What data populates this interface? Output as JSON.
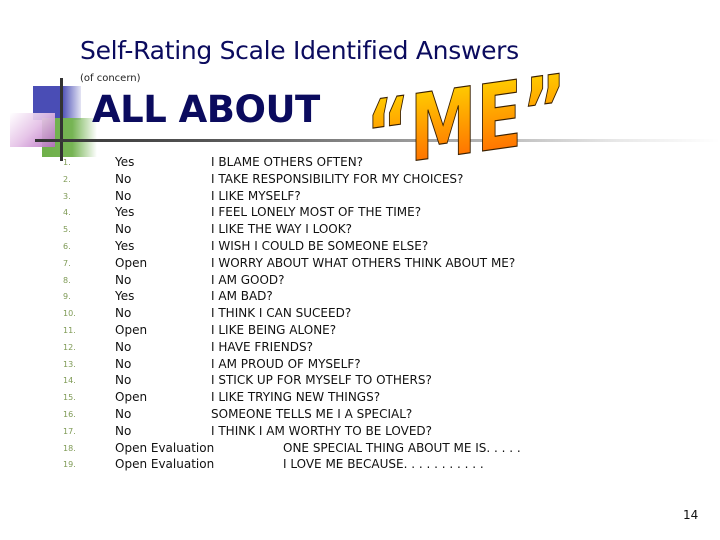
{
  "slide": {
    "title": "Self-Rating Scale Identified Answers",
    "subtitle": "(of concern)",
    "heading": "ALL ABOUT",
    "wordart": "“ME”",
    "page_number": "14"
  },
  "colors": {
    "title": "#0b0b5e",
    "number_marker": "#7e9a55",
    "wordart_top": "#ffe000",
    "wordart_bottom": "#ff5a00"
  },
  "items": [
    {
      "num": "1.",
      "answer": "Yes",
      "question": "I BLAME OTHERS OFTEN?"
    },
    {
      "num": "2.",
      "answer": "No",
      "question": "I TAKE RESPONSIBILITY FOR MY CHOICES?"
    },
    {
      "num": "3.",
      "answer": "No",
      "question": "I LIKE MYSELF?"
    },
    {
      "num": "4.",
      "answer": "Yes",
      "question": "I FEEL LONELY MOST OF THE TIME?"
    },
    {
      "num": "5.",
      "answer": "No",
      "question": "I LIKE THE WAY I LOOK?"
    },
    {
      "num": "6.",
      "answer": "Yes",
      "question": "I WISH I COULD BE SOMEONE ELSE?"
    },
    {
      "num": "7.",
      "answer": "Open",
      "question": "I WORRY ABOUT WHAT OTHERS THINK ABOUT ME?"
    },
    {
      "num": "8.",
      "answer": "No",
      "question": "I AM GOOD?"
    },
    {
      "num": "9.",
      "answer": "Yes",
      "question": "I AM BAD?"
    },
    {
      "num": "10.",
      "answer": "No",
      "question": "I THINK I CAN SUCEED?"
    },
    {
      "num": "11.",
      "answer": "Open",
      "question": "I LIKE BEING ALONE?"
    },
    {
      "num": "12.",
      "answer": "No",
      "question": "I HAVE FRIENDS?"
    },
    {
      "num": "13.",
      "answer": "No",
      "question": "I AM PROUD OF MYSELF?"
    },
    {
      "num": "14.",
      "answer": "No",
      "question": "I STICK UP FOR MYSELF TO OTHERS?"
    },
    {
      "num": "15.",
      "answer": "Open",
      "question": "I LIKE TRYING NEW THINGS?"
    },
    {
      "num": "16.",
      "answer": "No",
      "question": "SOMEONE TELLS ME I A SPECIAL?"
    },
    {
      "num": "17.",
      "answer": "No",
      "question": "I THINK I AM WORTHY TO BE LOVED?"
    },
    {
      "num": "18.",
      "answer": "Open Evaluation",
      "question": "ONE SPECIAL THING ABOUT ME IS. . . . ."
    },
    {
      "num": "19.",
      "answer": "Open Evaluation",
      "question": "I LOVE ME BECAUSE. . . . . . . . . . ."
    }
  ]
}
